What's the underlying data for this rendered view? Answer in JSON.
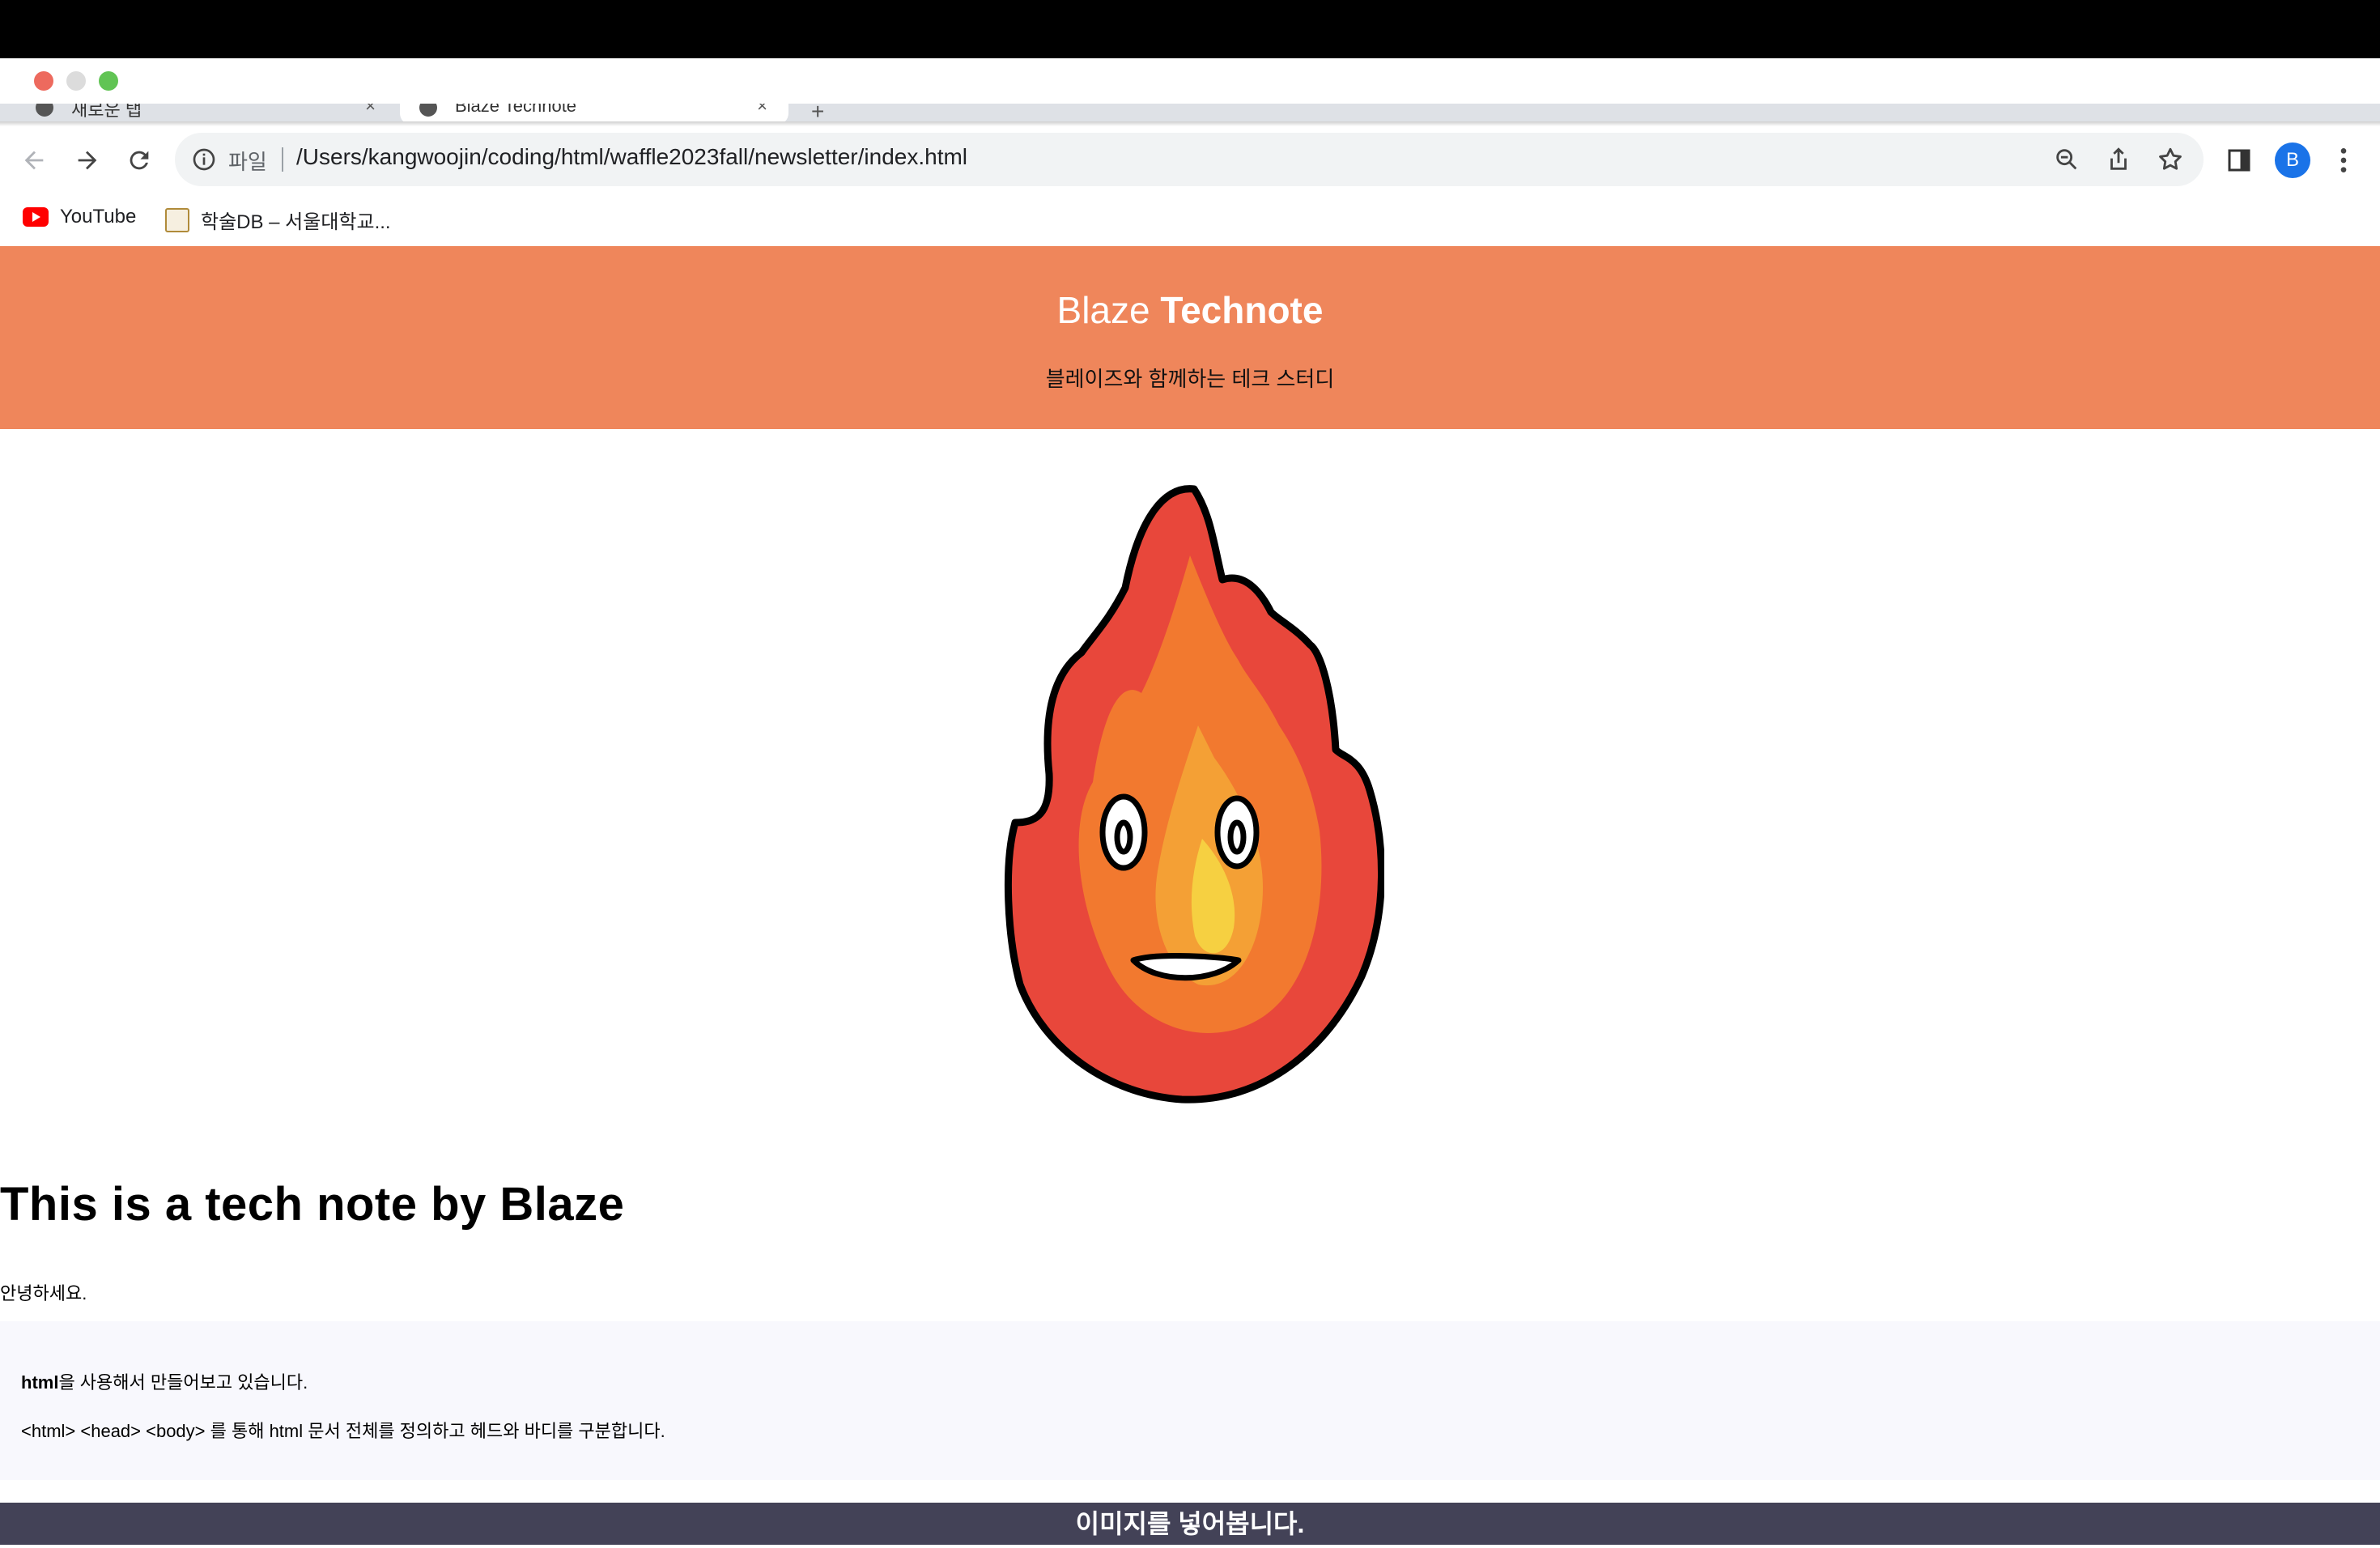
{
  "browser": {
    "tabs": [
      {
        "title": "새로운 탭",
        "close": "×"
      },
      {
        "title": "Blaze Technote",
        "close": "×"
      }
    ],
    "new_tab": "+",
    "address": {
      "scheme_label": "파일",
      "url": "/Users/kangwoojin/coding/html/waffle2023fall/newsletter/index.html"
    },
    "profile_initial": "B",
    "bookmarks": [
      {
        "label": "YouTube",
        "icon": "youtube-icon"
      },
      {
        "label": "학술DB – 서울대학교...",
        "icon": "bookmark-folder-icon"
      }
    ]
  },
  "page": {
    "header": {
      "brand_light": "Blaze ",
      "brand_bold": "Technote",
      "tagline": "블레이즈와 함께하는 테크 스터디",
      "background_color": "#ef865b"
    },
    "mascot": {
      "icon": "flame-mascot-image"
    },
    "hero_title": "This is a tech note by Blaze",
    "greeting": "안녕하세요.",
    "note": {
      "line1_bold": "html",
      "line1_rest": "을 사용해서 만들어보고 있습니다.",
      "line2": "<html> <head> <body> 를 통해 html 문서 전체를 정의하고 헤드와 바디를 구분합니다."
    },
    "footer_bar": {
      "text": "이미지를 넣어봅니다.",
      "background_color": "#434257"
    }
  }
}
